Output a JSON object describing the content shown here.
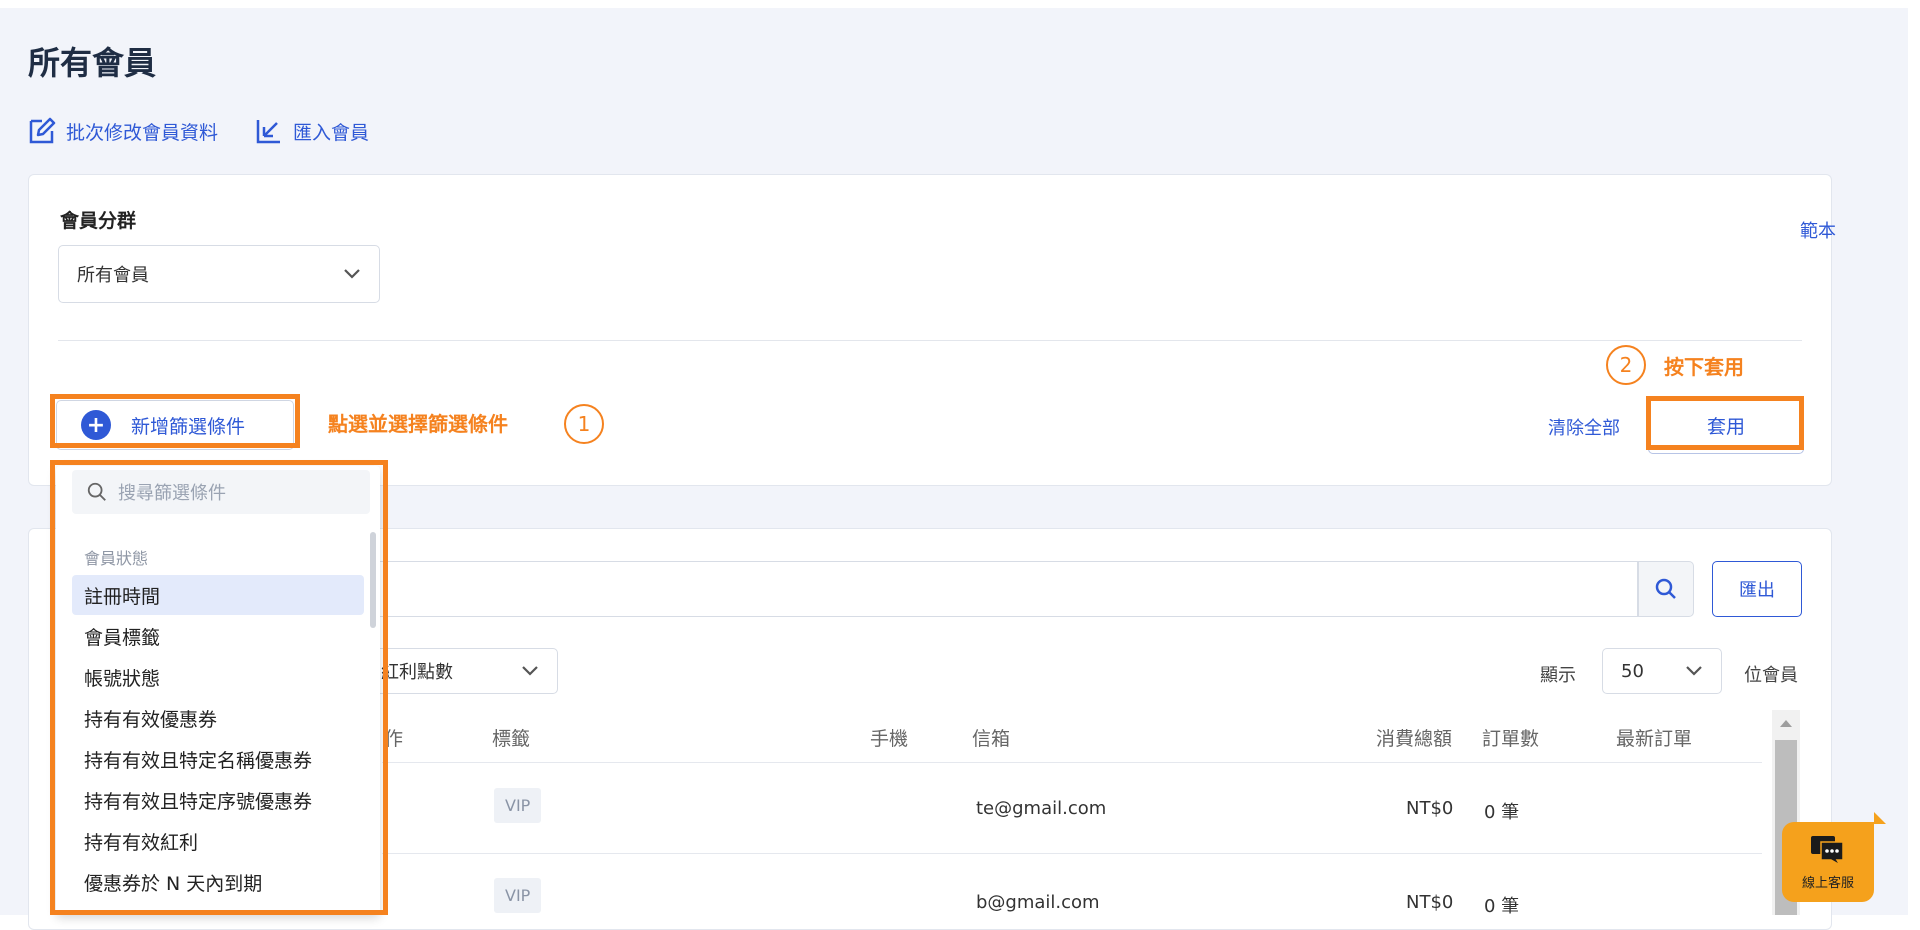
{
  "page": {
    "title": "所有會員"
  },
  "actions": {
    "batch_edit": "批次修改會員資料",
    "import": "匯入會員"
  },
  "segment": {
    "title": "會員分群",
    "sample_link": "範本",
    "selected": "所有會員",
    "add_filter": "新增篩選條件",
    "clear_all": "清除全部",
    "apply": "套用"
  },
  "annotations": {
    "step1_text": "點選並選擇篩選條件",
    "step1_num": "1",
    "step2_text": "按下套用",
    "step2_num": "2"
  },
  "filter_dropdown": {
    "search_placeholder": "搜尋篩選條件",
    "group_label": "會員狀態",
    "items": [
      "註冊時間",
      "會員標籤",
      "帳號狀態",
      "持有有效優惠券",
      "持有有效且特定名稱優惠券",
      "持有有效且特定序號優惠券",
      "持有有效紅利",
      "優惠券於 N 天內到期"
    ]
  },
  "list": {
    "export": "匯出",
    "sort_partial": "紅利點數",
    "show_label": "顯示",
    "page_size": "50",
    "per_label": "位會員",
    "headers": {
      "partial": "作",
      "tag": "標籤",
      "phone": "手機",
      "email": "信箱",
      "total": "消費總額",
      "orders": "訂單數",
      "latest": "最新訂單"
    },
    "rows": [
      {
        "tag": "VIP",
        "email": "te@gmail.com",
        "total": "NT$0",
        "orders": "0 筆"
      },
      {
        "tag": "VIP",
        "email": "b@gmail.com",
        "total": "NT$0",
        "orders": "0 筆"
      }
    ]
  },
  "support": {
    "label": "線上客服"
  },
  "colors": {
    "accent": "#2f59d6",
    "highlight": "#f5821f",
    "chat": "#f5a11c"
  }
}
